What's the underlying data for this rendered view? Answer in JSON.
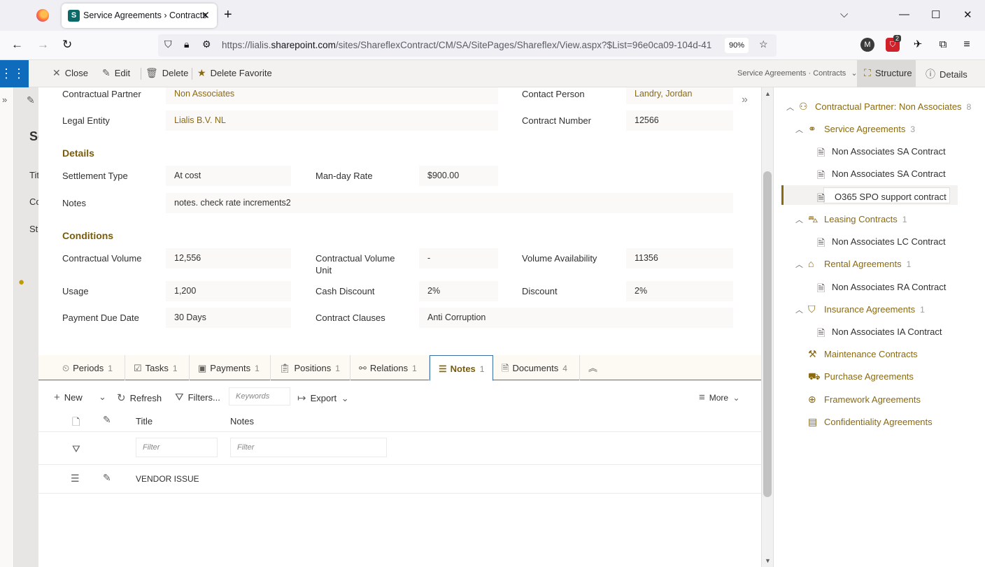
{
  "browser": {
    "tab_title": "Service Agreements › Contracts",
    "url_prefix": "https://lialis.",
    "url_domain": "sharepoint.com",
    "url_path": "/sites/ShareflexContract/CM/SA/SitePages/Shareflex/View.aspx?$List=96e0ca09-104d-41",
    "zoom": "90%",
    "ext_badge": "2",
    "ext_avatar": "M"
  },
  "commands": {
    "close": "Close",
    "edit": "Edit",
    "delete": "Delete",
    "delete_favorite": "Delete Favorite",
    "breadcrumb": "Service Agreements · Contracts",
    "structure": "Structure",
    "details": "Details"
  },
  "form": {
    "contractual_partner_label": "Contractual Partner",
    "contractual_partner_value": "Non Associates",
    "contact_person_label": "Contact Person",
    "contact_person_value": "Landry, Jordan",
    "legal_entity_label": "Legal Entity",
    "legal_entity_value": "Lialis B.V. NL",
    "contract_number_label": "Contract Number",
    "contract_number_value": "12566",
    "details_heading": "Details",
    "settlement_type_label": "Settlement Type",
    "settlement_type_value": "At cost",
    "manday_rate_label": "Man-day Rate",
    "manday_rate_value": "$900.00",
    "notes_label": "Notes",
    "notes_value": "notes. check rate increments2",
    "conditions_heading": "Conditions",
    "contractual_volume_label": "Contractual Volume",
    "contractual_volume_value": "12,556",
    "contractual_volume_unit_label_1": "Contractual Volume",
    "contractual_volume_unit_label_2": "Unit",
    "contractual_volume_unit_value": "-",
    "volume_availability_label": "Volume Availability",
    "volume_availability_value": "11356",
    "usage_label": "Usage",
    "usage_value": "1,200",
    "cash_discount_label": "Cash Discount",
    "cash_discount_value": "2%",
    "discount_label": "Discount",
    "discount_value": "2%",
    "payment_due_label": "Payment Due Date",
    "payment_due_value": "30 Days",
    "contract_clauses_label": "Contract Clauses",
    "contract_clauses_value": "Anti Corruption"
  },
  "tabs": [
    {
      "label": "Periods",
      "count": "1"
    },
    {
      "label": "Tasks",
      "count": "1"
    },
    {
      "label": "Payments",
      "count": "1"
    },
    {
      "label": "Positions",
      "count": "1"
    },
    {
      "label": "Relations",
      "count": "1"
    },
    {
      "label": "Notes",
      "count": "1"
    },
    {
      "label": "Documents",
      "count": "4"
    }
  ],
  "toolbar": {
    "new": "New",
    "refresh": "Refresh",
    "filters": "Filters...",
    "keywords_placeholder": "Keywords",
    "export": "Export",
    "more": "More"
  },
  "grid": {
    "col_title": "Title",
    "col_notes": "Notes",
    "filter_placeholder": "Filter",
    "rows": [
      {
        "title": "VENDOR ISSUE"
      }
    ]
  },
  "tree": {
    "root": {
      "label": "Contractual Partner: Non Associates",
      "count": "8"
    },
    "service": {
      "label": "Service Agreements",
      "count": "3"
    },
    "sa1": "Non Associates SA Contract",
    "sa2": "Non Associates SA Contract",
    "sa3": "O365 SPO support contract",
    "leasing": {
      "label": "Leasing Contracts",
      "count": "1"
    },
    "lc1": "Non Associates LC Contract",
    "rental": {
      "label": "Rental Agreements",
      "count": "1"
    },
    "ra1": "Non Associates RA Contract",
    "insurance": {
      "label": "Insurance Agreements",
      "count": "1"
    },
    "ia1": "Non Associates IA Contract",
    "maintenance": "Maintenance Contracts",
    "purchase": "Purchase Agreements",
    "framework": "Framework Agreements",
    "confidentiality": "Confidentiality Agreements"
  },
  "background": {
    "frag_heading": "Se",
    "frag_1": "Tit",
    "frag_2": "Co",
    "frag_3": "St"
  }
}
